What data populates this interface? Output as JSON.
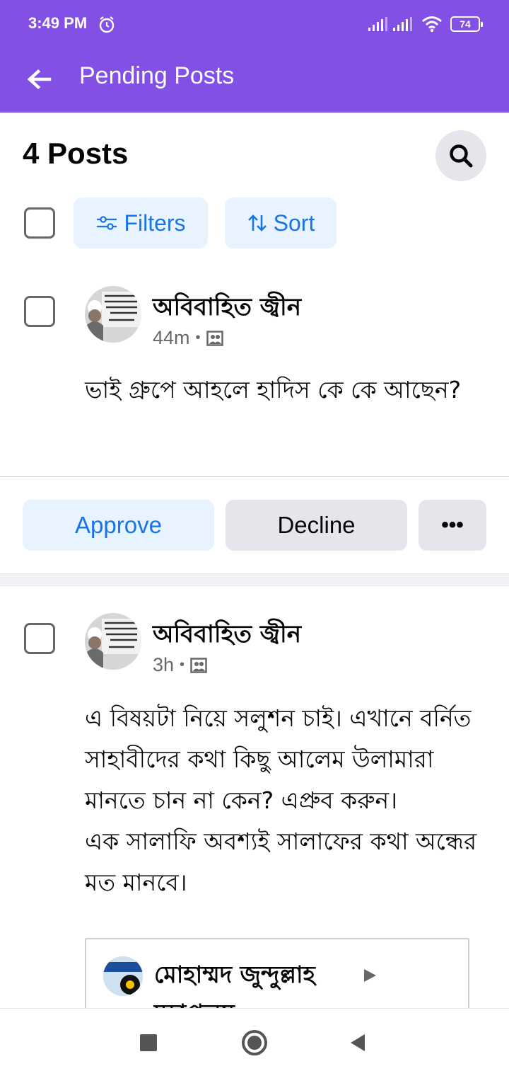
{
  "status_bar": {
    "time": "3:49 PM",
    "battery": "74"
  },
  "app_bar": {
    "title": "Pending Posts"
  },
  "header": {
    "count_label": "4 Posts"
  },
  "toolbar": {
    "filters_label": "Filters",
    "sort_label": "Sort"
  },
  "posts": [
    {
      "author": "অবিবাহিত জ্বীন",
      "time": "44m",
      "text": "ভাই গ্রুপে আহলে হাদিস কে কে আছেন?"
    },
    {
      "author": "অবিবাহিত জ্বীন",
      "time": "3h",
      "text": "এ বিষয়টা নিয়ে সলুশন চাই। এখানে বর্নিত সাহাবীদের কথা কিছু আলেম উলামারা মানতে চান না কেন? এপ্রুব করুন।\nএক সালাফি অবশ্যই সালাফের কথা অন্ধের মত মানবে।",
      "shared": {
        "author": "মোহাম্মদ জুন্দুল্লাহ",
        "author_line2": "মহাপ্রলয়"
      }
    }
  ],
  "actions": {
    "approve_label": "Approve",
    "decline_label": "Decline",
    "more_label": "•••"
  },
  "icons": {
    "alarm": "alarm-icon",
    "signal": "signal-icon",
    "wifi": "wifi-icon",
    "back": "arrow-left-icon",
    "search": "search-icon",
    "filters": "sliders-icon",
    "sort": "sort-arrows-icon",
    "photo": "photo-icon",
    "play": "triangle-right-icon"
  },
  "colors": {
    "brand": "#8250e4",
    "accent": "#1b74e4",
    "accent_bg": "#e7f3ff",
    "neutral_bg": "#e4e6eb"
  }
}
